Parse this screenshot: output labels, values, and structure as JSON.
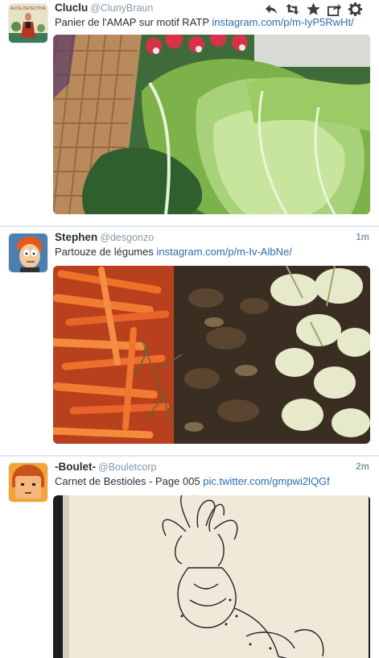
{
  "tweets": [
    {
      "fullname": "Cluclu",
      "username": "@ClunyBraun",
      "time": "",
      "text": "Panier de l'AMAP sur motif RATP",
      "link": "instagram.com/p/m-IyP5RwHt/",
      "avatar_text": "ALICE DETECTIVE",
      "media": "photo of vegetables: radishes, lettuce and chard in a wicker basket"
    },
    {
      "fullname": "Stephen",
      "username": "@desgonzo",
      "time": "1m",
      "text": "Partouze de légumes",
      "link": "instagram.com/p/m-Iv-AlbNe/",
      "media": "photo of vegetables: carrots, thyme, roasted eggplant and fennel"
    },
    {
      "fullname": "-Boulet-",
      "username": "@Bouletcorp",
      "time": "2m",
      "text": "Carnet de Bestioles - Page 005",
      "link": "pic.twitter.com/gmpwi2lQGf",
      "media": "ink drawing of a creature on a sketchbook page"
    }
  ],
  "actions": [
    "reply-icon",
    "retweet-icon",
    "favorite-icon",
    "share-icon",
    "more-icon"
  ],
  "colors": {
    "link": "#2a6db0",
    "meta": "#8899a6",
    "name": "#292f33",
    "border": "#e1e8ed"
  }
}
